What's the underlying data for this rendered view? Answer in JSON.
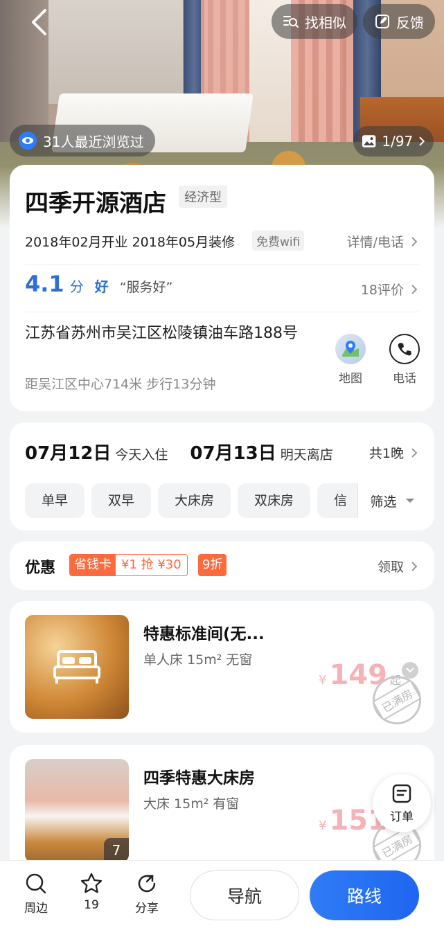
{
  "header": {
    "find_similar": "找相似",
    "feedback": "反馈",
    "viewers": "31人最近浏览过",
    "photo_count": "1/97"
  },
  "hotel": {
    "name": "四季开源酒店",
    "type_tag": "经济型",
    "meta": "2018年02月开业 2018年05月装修",
    "wifi_tag": "免费wifi",
    "detail_link": "详情/电话",
    "score": "4.1",
    "score_unit": "分",
    "score_word": "好",
    "quote": "“服务好”",
    "reviews": "18评价",
    "address": "江苏省苏州市吴江区松陵镇油车路188号",
    "distance": "距吴江区中心714米 步行13分钟",
    "map_label": "地图",
    "phone_label": "电话"
  },
  "dates": {
    "checkin_date": "07月12日",
    "checkin_label": "今天入住",
    "checkout_date": "07月13日",
    "checkout_label": "明天离店",
    "nights": "共1晚",
    "filters": [
      "单早",
      "双早",
      "大床房",
      "双床房",
      "信"
    ],
    "filter_button": "筛选"
  },
  "promo": {
    "title": "优惠",
    "badge_left": "省钱卡",
    "badge_right": "¥1 抢 ¥30",
    "discount": "9折",
    "claim": "领取"
  },
  "rooms": [
    {
      "name": "特惠标准间(无...",
      "spec": "单人床 15m² 无窗",
      "currency": "¥",
      "price": "149",
      "suffix": "起",
      "stamp": "已满房"
    },
    {
      "name": "四季特惠大床房",
      "spec": "大床 15m² 有窗",
      "currency": "¥",
      "price": "151",
      "image_count": "7",
      "stamp": "已满房"
    }
  ],
  "order_fab": "订单",
  "bottom_bar": {
    "nearby": "周边",
    "favorites_count": "19",
    "share": "分享",
    "navigate": "导航",
    "route": "路线"
  },
  "colors": {
    "accent_blue": "#2d6fd6",
    "promo_orange": "#ff6a3d",
    "route_button": "#1f66ef"
  }
}
